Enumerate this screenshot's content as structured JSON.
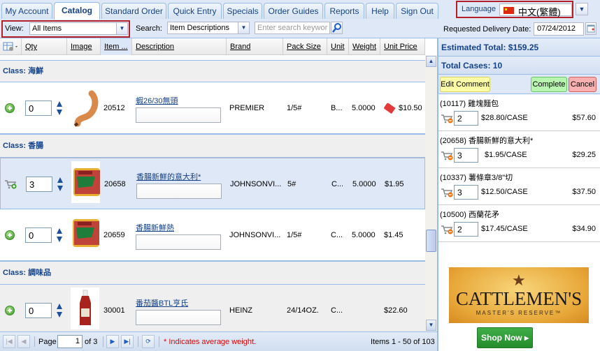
{
  "tabs": [
    {
      "label": "My Account",
      "active": false
    },
    {
      "label": "Catalog",
      "active": true
    },
    {
      "label": "Standard Order",
      "active": false
    },
    {
      "label": "Quick Entry",
      "active": false
    },
    {
      "label": "Specials",
      "active": false
    },
    {
      "label": "Order Guides",
      "active": false
    },
    {
      "label": "Reports",
      "active": false
    },
    {
      "label": "Help",
      "active": false
    },
    {
      "label": "Sign Out",
      "active": false
    }
  ],
  "language": {
    "label": "Language",
    "value": "中文(繁體)",
    "flag": "china-flag-icon"
  },
  "toolbar": {
    "view_label": "View:",
    "view_value": "All Items",
    "search_label": "Search:",
    "search_by": "Item Descriptions",
    "search_placeholder": "Enter search keywor",
    "delivery_label": "Requested Delivery Date:",
    "delivery_date": "07/24/2012"
  },
  "columns": [
    "Qty",
    "Image",
    "Item ...",
    "Description",
    "Brand",
    "Pack Size",
    "Unit",
    "Weight",
    "Unit Price"
  ],
  "groups": [
    {
      "label": "Class: 海鮮"
    },
    {
      "label": "Class: 香腸"
    },
    {
      "label": "Class: 調味品"
    }
  ],
  "rows": [
    {
      "action": "add",
      "qty": "0",
      "item": "20512",
      "desc": "蝦26/30無頭",
      "brand": "PREMIER",
      "pack": "1/5#",
      "unit": "B...",
      "weight": "5.0000",
      "price": "$10.50",
      "special": true,
      "image": "shrimp"
    },
    {
      "action": "in-cart",
      "qty": "3",
      "item": "20658",
      "desc": "香腸新鮮的意大利*",
      "brand": "JOHNSONVI...",
      "pack": "5#",
      "unit": "C...",
      "weight": "5.0000",
      "price": "$1.95",
      "special": false,
      "image": "sausage"
    },
    {
      "action": "add",
      "qty": "0",
      "item": "20659",
      "desc": "香腸新鮮熱",
      "brand": "JOHNSONVI...",
      "pack": "1/5#",
      "unit": "C...",
      "weight": "5.0000",
      "price": "$1.45",
      "special": false,
      "image": "sausage"
    },
    {
      "action": "add",
      "qty": "0",
      "item": "30001",
      "desc": "番茄醬BTL亨氏",
      "brand": "HEINZ",
      "pack": "24/14OZ.",
      "unit": "C...",
      "weight": "",
      "price": "$22.60",
      "special": false,
      "image": "ketchup"
    }
  ],
  "pager": {
    "page_label": "Page",
    "page": "1",
    "of_label": "of 3",
    "note": "* Indicates average weight.",
    "summary": "Items 1 - 50 of 103"
  },
  "cart": {
    "estimated_total": "Estimated Total: $159.25",
    "total_cases": "Total Cases: 10",
    "edit_comment": "Edit Comment",
    "complete": "Complete",
    "cancel": "Cancel",
    "items": [
      {
        "title": "(10117) 雞塊麵包",
        "qty": "2",
        "price": "$28.80/CASE",
        "total": "$57.60"
      },
      {
        "title": "(20658) 香腸新鮮的意大利*",
        "qty": "3",
        "price": "$1.95/CASE",
        "total": "$29.25"
      },
      {
        "title": "(10337) 薯條章3/8\"切",
        "qty": "3",
        "price": "$12.50/CASE",
        "total": "$37.50"
      },
      {
        "title": "(10500) 西蘭花矛",
        "qty": "2",
        "price": "$17.45/CASE",
        "total": "$34.90"
      }
    ]
  },
  "ad": {
    "brand": "CATTLEMEN'S",
    "sub": "MASTER'S RESERVE™",
    "cta": "Shop Now ▸"
  },
  "colors": {
    "accent": "#15428b",
    "highlight_border": "#b3202a",
    "note": "#e00000"
  }
}
